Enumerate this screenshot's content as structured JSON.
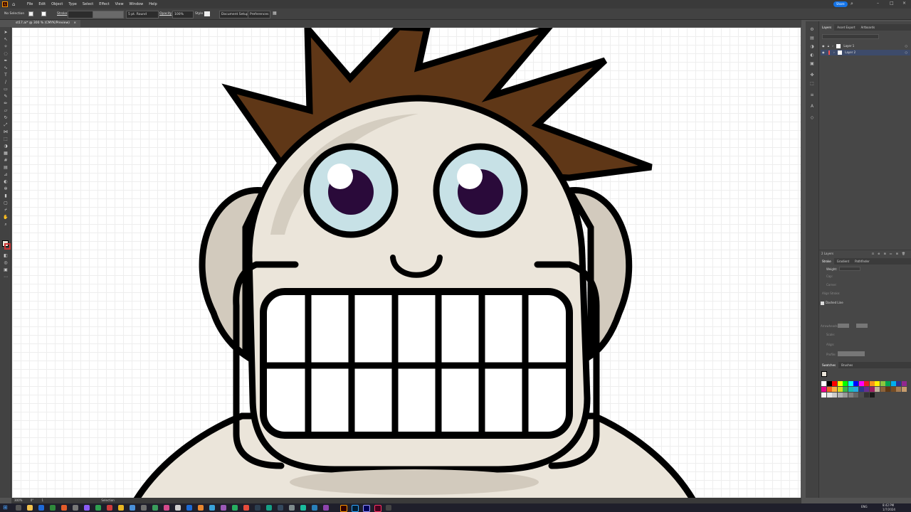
{
  "menubar": {
    "items": [
      "File",
      "Edit",
      "Object",
      "Type",
      "Select",
      "Effect",
      "View",
      "Window",
      "Help"
    ],
    "share_label": "Share"
  },
  "controlbar": {
    "selection_label": "No Selection",
    "stroke_label": "Stroke",
    "brush_value": "5 pt. Round",
    "opacity_label": "Opacity",
    "opacity_value": "100%",
    "style_label": "Style",
    "document_setup": "Document Setup",
    "preferences": "Preferences"
  },
  "document_tab": {
    "title": "st17.ai* @ 300 % (CMYK/Preview)",
    "close": "×"
  },
  "layers_panel": {
    "tabs": [
      "Layers",
      "Asset Export",
      "Artboards"
    ],
    "layers": [
      {
        "name": "Layer 1",
        "color": "#4f7cff"
      },
      {
        "name": "Layer 2",
        "color": "#ff4f4f"
      }
    ],
    "footer": "2 Layers"
  },
  "stroke_panel": {
    "tabs": [
      "Stroke",
      "Gradient",
      "Pathfinder"
    ],
    "weight_label": "Weight:",
    "cap_label": "Cap:",
    "corner_label": "Corner:",
    "align_label": "Align Stroke:",
    "dashed_label": "Dashed Line",
    "arrowheads_label": "Arrowheads:",
    "scale_label": "Scale:",
    "align_arrow_label": "Align:",
    "profile_label": "Profile:"
  },
  "swatches_panel": {
    "tabs": [
      "Swatches",
      "Brushes"
    ],
    "colors": [
      "#ffffff",
      "#000000",
      "#ff0000",
      "#ffff00",
      "#00ff00",
      "#00ffff",
      "#0000ff",
      "#ff00ff",
      "#ed1c24",
      "#f7941d",
      "#fff200",
      "#8dc63f",
      "#00a651",
      "#00aeef",
      "#2e3192",
      "#92278f",
      "#ec008c",
      "#f26522",
      "#fbb040",
      "#d7df23",
      "#39b54a",
      "#1cbbb4",
      "#27aae1",
      "#2b388f",
      "#662d91",
      "#9e1f63",
      "#c2b59b",
      "#8c6239",
      "#603913",
      "#754c24",
      "#a67c52",
      "#c69c6d",
      "#f2f2f2",
      "#e6e6e6",
      "#cccccc",
      "#b3b3b3",
      "#999999",
      "#808080",
      "#666666",
      "#4d4d4d",
      "#333333",
      "#1a1a1a"
    ]
  },
  "statusbar": {
    "zoom": "300%",
    "angle": "0°",
    "page": "1",
    "tool": "Selection"
  },
  "taskbar": {
    "time": "8:42 PM",
    "date": "1/7/2024",
    "lang": "ENG"
  },
  "colors": {
    "hair": "#5f3717",
    "skin": "#ebe5da",
    "shade": "#d2cabd",
    "iris": "#c7e1e6",
    "pupil": "#2a0a3a",
    "outline": "#000000"
  }
}
